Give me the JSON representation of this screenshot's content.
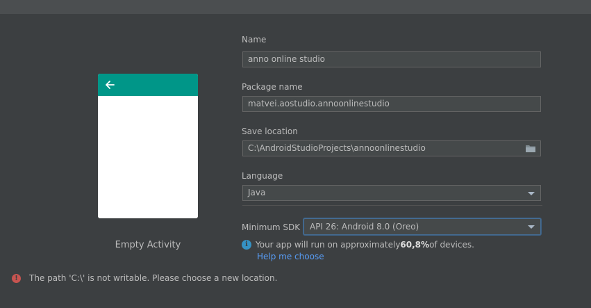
{
  "form": {
    "name_label": "Name",
    "name_value": "anno online studio",
    "package_label": "Package name",
    "package_value": "matvei.aostudio.annoonlinestudio",
    "location_label": "Save location",
    "location_value": "C:\\AndroidStudioProjects\\annoonlinestudio",
    "language_label": "Language",
    "language_value": "Java",
    "min_sdk_label": "Minimum SDK",
    "min_sdk_value": "API 26: Android 8.0 (Oreo)"
  },
  "info": {
    "text_before": "Your app will run on approximately ",
    "percent": "60,8%",
    "text_after": " of devices.",
    "help_link": "Help me choose"
  },
  "template": {
    "name": "Empty Activity",
    "toolbar_color": "#009688"
  },
  "error": {
    "message": "The path 'C:\\' is not writable. Please choose a new location."
  },
  "icons": {
    "back": "arrow-left-icon",
    "folder": "folder-icon",
    "info": "info-icon",
    "error": "error-icon"
  }
}
